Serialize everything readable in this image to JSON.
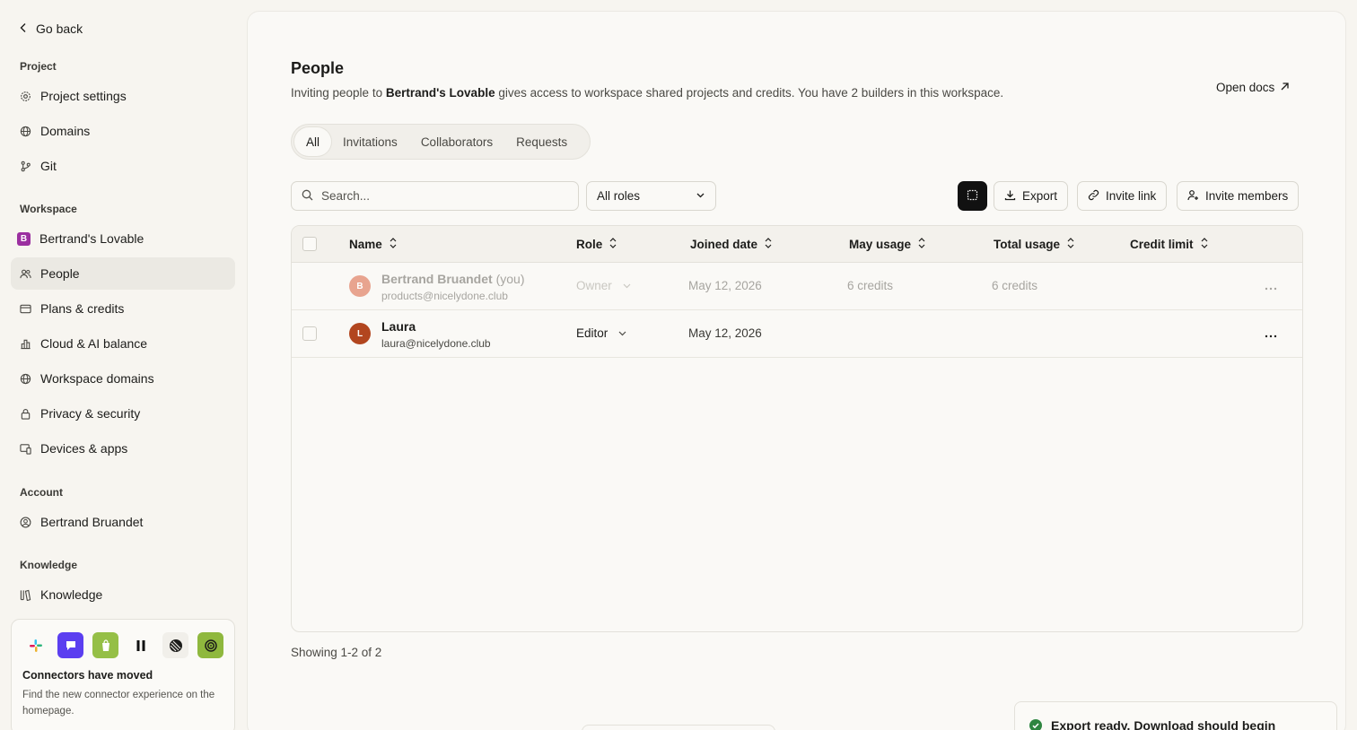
{
  "sidebar": {
    "go_back": "Go back",
    "sections": {
      "project": "Project",
      "workspace": "Workspace",
      "account": "Account",
      "knowledge": "Knowledge"
    },
    "project_items": [
      {
        "label": "Project settings",
        "icon": "gear-icon"
      },
      {
        "label": "Domains",
        "icon": "globe-icon"
      },
      {
        "label": "Git",
        "icon": "git-icon"
      }
    ],
    "workspace_items": [
      {
        "label": "Bertrand's Lovable",
        "icon": "workspace-badge",
        "badge": "B"
      },
      {
        "label": "People",
        "icon": "people-icon",
        "active": true
      },
      {
        "label": "Plans & credits",
        "icon": "credit-card-icon"
      },
      {
        "label": "Cloud & AI balance",
        "icon": "bar-chart-icon"
      },
      {
        "label": "Workspace domains",
        "icon": "globe-icon"
      },
      {
        "label": "Privacy & security",
        "icon": "lock-icon"
      },
      {
        "label": "Devices & apps",
        "icon": "devices-icon"
      }
    ],
    "account_items": [
      {
        "label": "Bertrand Bruandet",
        "icon": "user-circle-icon"
      }
    ],
    "knowledge_items": [
      {
        "label": "Knowledge",
        "icon": "library-icon"
      }
    ],
    "connectors_card": {
      "title": "Connectors have moved",
      "description": "Find the new connector experience on the homepage.",
      "icons": [
        "slack-icon",
        "chat-icon",
        "shopify-icon",
        "pause-icon",
        "linear-icon",
        "spiral-icon"
      ]
    }
  },
  "main": {
    "title": "People",
    "description_prefix": "Inviting people to ",
    "description_workspace": "Bertrand's Lovable",
    "description_suffix": " gives access to workspace shared projects and credits. You have 2 builders in this workspace.",
    "open_docs": "Open docs",
    "tabs": [
      {
        "label": "All",
        "active": true
      },
      {
        "label": "Invitations"
      },
      {
        "label": "Collaborators"
      },
      {
        "label": "Requests"
      }
    ],
    "search": {
      "placeholder": "Search..."
    },
    "roles_filter": "All roles",
    "buttons": {
      "export": "Export",
      "invite_link": "Invite link",
      "invite_members": "Invite members"
    },
    "table": {
      "columns": [
        "Name",
        "Role",
        "Joined date",
        "May usage",
        "Total usage",
        "Credit limit"
      ],
      "rows": [
        {
          "initial": "B",
          "name": "Bertrand Bruandet",
          "you": "(you)",
          "email": "products@nicelydone.club",
          "role": "Owner",
          "joined": "May 12, 2026",
          "may_usage": "6 credits",
          "total_usage": "6 credits",
          "credit_limit": "",
          "avatar_color": "#e8a48f"
        },
        {
          "initial": "L",
          "name": "Laura",
          "you": "",
          "email": "laura@nicelydone.club",
          "role": "Editor",
          "joined": "May 12, 2026",
          "may_usage": "",
          "total_usage": "",
          "credit_limit": "",
          "avatar_color": "#b2461f"
        }
      ]
    },
    "showing": "Showing 1-2 of 2"
  },
  "toast": {
    "text": "Export ready. Download should begin"
  }
}
